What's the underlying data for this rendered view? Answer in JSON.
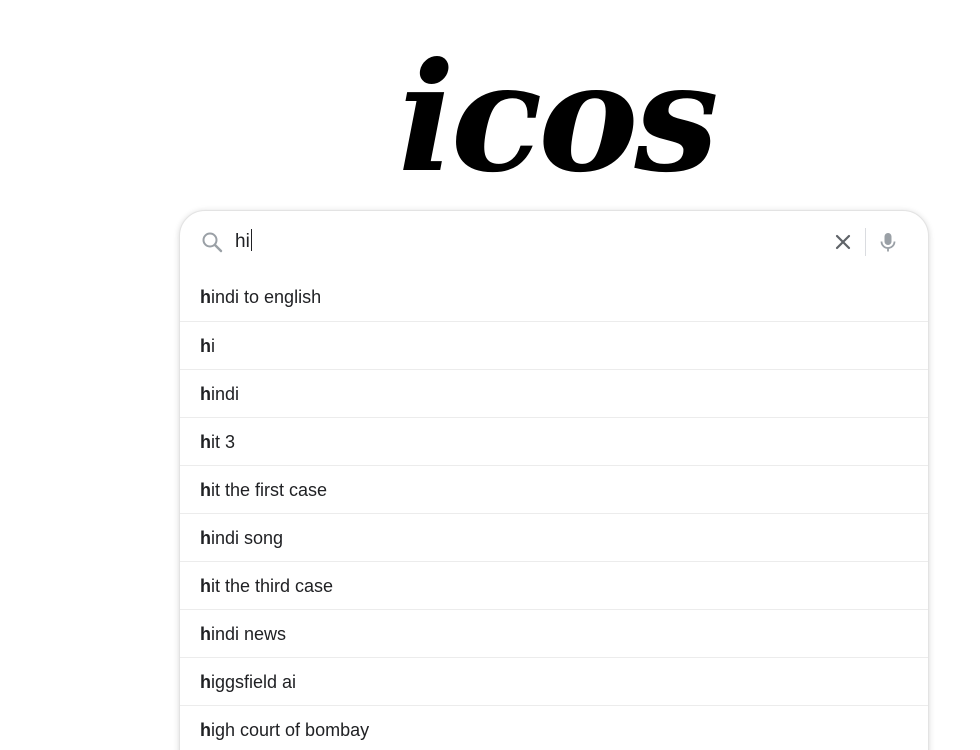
{
  "logo": {
    "text": "icos"
  },
  "search": {
    "query": "hi",
    "clear_icon": "close-icon",
    "mic_icon": "microphone-icon",
    "search_icon": "magnifier-icon"
  },
  "suggestions": [
    {
      "prefix": "h",
      "rest": "indi to english"
    },
    {
      "prefix": "h",
      "rest": "i"
    },
    {
      "prefix": "h",
      "rest": "indi"
    },
    {
      "prefix": "h",
      "rest": "it 3"
    },
    {
      "prefix": "h",
      "rest": "it the first case"
    },
    {
      "prefix": "h",
      "rest": "indi song"
    },
    {
      "prefix": "h",
      "rest": "it the third case"
    },
    {
      "prefix": "h",
      "rest": "indi news"
    },
    {
      "prefix": "h",
      "rest": "iggsfield ai"
    },
    {
      "prefix": "h",
      "rest": "igh court of bombay"
    }
  ]
}
